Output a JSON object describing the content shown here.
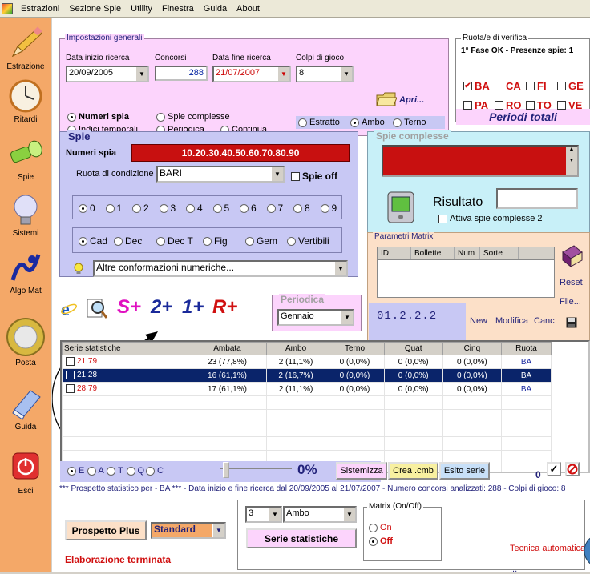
{
  "menu": [
    "Estrazioni",
    "Sezione Spie",
    "Utility",
    "Finestra",
    "Guida",
    "About"
  ],
  "sidebar": [
    {
      "label": "Estrazione",
      "icon": "pencil-icon"
    },
    {
      "label": "Ritardi",
      "icon": "clock-icon"
    },
    {
      "label": "Spie",
      "icon": "flashlight-icon"
    },
    {
      "label": "Sistemi",
      "icon": "lightbulb-icon"
    },
    {
      "label": "Algo Mat",
      "icon": "lottery-logo-icon"
    },
    {
      "label": "Posta",
      "icon": "euro-coin-icon"
    },
    {
      "label": "Guida",
      "icon": "guide-book-icon"
    },
    {
      "label": "Esci",
      "icon": "power-icon"
    }
  ],
  "general": {
    "title": "Impostazioni generali",
    "start_label": "Data inizio ricerca",
    "start_value": "20/09/2005",
    "concorsi_label": "Concorsi",
    "concorsi_value": "288",
    "end_label": "Data fine ricerca",
    "end_value": "21/07/2007",
    "colpi_label": "Colpi di gioco",
    "colpi_value": "8",
    "open_label": "Apri...",
    "opt_numeri_spia": "Numeri spia",
    "opt_spie_complesse": "Spie complesse",
    "opt_indici": "Indici temporali",
    "opt_periodica": "Periodica",
    "opt_continua": "Continua",
    "opt_estratto": "Estratto",
    "opt_ambo": "Ambo",
    "opt_terno": "Terno"
  },
  "ruota": {
    "title": "Ruota/e di verifica",
    "status": "1° Fase OK - Presenze spie: 1",
    "wheels": [
      {
        "label": "BA",
        "checked": "✔"
      },
      {
        "label": "CA",
        "checked": ""
      },
      {
        "label": "FI",
        "checked": ""
      },
      {
        "label": "GE",
        "checked": ""
      },
      {
        "label": "PA",
        "checked": ""
      },
      {
        "label": "RO",
        "checked": ""
      },
      {
        "label": "TO",
        "checked": ""
      },
      {
        "label": "VE",
        "checked": ""
      }
    ],
    "periodi": "Periodi totali"
  },
  "spie": {
    "title": "Spie",
    "numeri_label": "Numeri spia",
    "numeri_value": "10.20.30.40.50.60.70.80.90",
    "ruota_label": "Ruota di condizione",
    "ruota_value": "BARI",
    "spie_off": "Spie off",
    "digits": [
      "0",
      "1",
      "2",
      "3",
      "4",
      "5",
      "6",
      "7",
      "8",
      "9"
    ],
    "modes": [
      "Cad",
      "Dec",
      "Dec T",
      "Fig",
      "Gem",
      "Vertibili"
    ],
    "altre": "Altre conformazioni numeriche..."
  },
  "complesse": {
    "title": "Spie complesse",
    "risultato": "Risultato",
    "attiva": "Attiva spie complesse 2"
  },
  "matrix": {
    "title": "Parametri Matrix",
    "cols": [
      "ID",
      "Bollette",
      "Num",
      "Sorte"
    ],
    "reset": "Reset",
    "file": "File...",
    "code": "01.2.2.2",
    "new": "New",
    "modifica": "Modifica",
    "canc": "Canc"
  },
  "toolbar": {
    "s_plus": "S+",
    "two_plus": "2+",
    "one_plus": "1+",
    "r_plus": "R+"
  },
  "periodica": {
    "title": "Periodica",
    "value": "Gennaio"
  },
  "grid": {
    "headers": [
      "Serie statistiche",
      "Ambata",
      "Ambo",
      "Terno",
      "Quat",
      "Cinq",
      "Ruota"
    ],
    "rows": [
      [
        "21.79",
        "23 (77,8%)",
        "2 (11,1%)",
        "0 (0,0%)",
        "0 (0,0%)",
        "0 (0,0%)",
        "BA"
      ],
      [
        "21.28",
        "16 (61,1%)",
        "2 (16,7%)",
        "0 (0,0%)",
        "0 (0,0%)",
        "0 (0,0%)",
        "BA"
      ],
      [
        "28.79",
        "17 (61,1%)",
        "2 (11,1%)",
        "0 (0,0%)",
        "0 (0,0%)",
        "0 (0,0%)",
        "BA"
      ]
    ]
  },
  "bottom": {
    "sorte_radios": [
      "E",
      "A",
      "T",
      "Q",
      "C"
    ],
    "percent": "0%",
    "sistemizza": "Sistemizza",
    "crea_cmb": "Crea .cmb",
    "esito": "Esito serie",
    "counter": "0",
    "check": "✓",
    "prospetto": "*** Prospetto statistico per  - BA *** - Data inizio e fine ricerca dal 20/09/2005 al 21/07/2007 - Numero concorsi analizzati: 288 - Colpi di gioco: 8",
    "prospetto_plus": "Prospetto Plus",
    "standard": "Standard",
    "elaborazione": "Elaborazione terminata",
    "num_value": "3",
    "sorte_value": "Ambo",
    "serie_btn": "Serie statistiche",
    "matrix_title": "Matrix (On/Off)",
    "on": "On",
    "off": "Off",
    "tecnica": "Tecnica automatica",
    "dots": "..."
  }
}
